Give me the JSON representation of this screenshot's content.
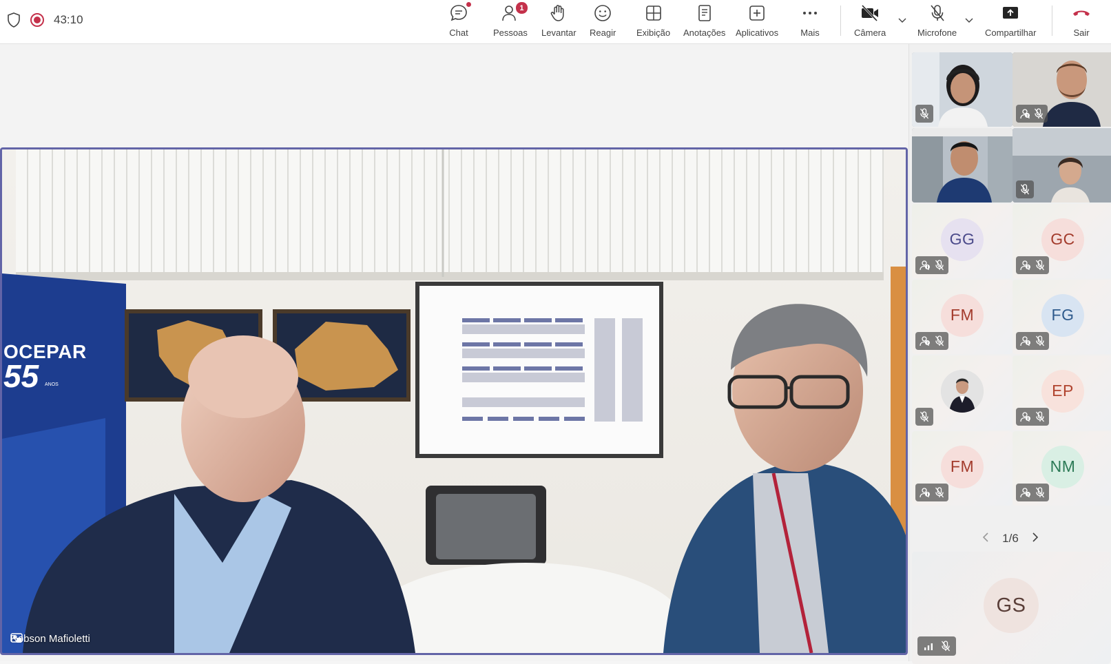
{
  "status": {
    "timer": "43:10"
  },
  "toolbar": {
    "chat": "Chat",
    "people": "Pessoas",
    "people_badge": "1",
    "raise": "Levantar",
    "react": "Reagir",
    "view": "Exibição",
    "notes": "Anotações",
    "apps": "Aplicativos",
    "more": "Mais",
    "camera": "Câmera",
    "mic": "Microfone",
    "share": "Compartilhar",
    "leave": "Sair"
  },
  "main_video": {
    "speaker_name": "Robson Mafioletti",
    "banner_text": "OCEPAR",
    "banner_year": "55",
    "banner_sub": "ANOS"
  },
  "gallery": {
    "tiles": [
      {
        "initials": "GG",
        "avatar_color": "#e6e1f0",
        "text_color": "#4b4a8a"
      },
      {
        "initials": "GC",
        "avatar_color": "#f6dedb",
        "text_color": "#a33b2c"
      },
      {
        "initials": "FM",
        "avatar_color": "#f6dedb",
        "text_color": "#a33b2c"
      },
      {
        "initials": "FG",
        "avatar_color": "#d8e4f2",
        "text_color": "#2e5a8c"
      },
      {
        "initials": "",
        "avatar_color": "#e0e0e0",
        "text_color": "#333333"
      },
      {
        "initials": "EP",
        "avatar_color": "#f8e2dc",
        "text_color": "#b0432e"
      },
      {
        "initials": "FM",
        "avatar_color": "#f6dedb",
        "text_color": "#a33b2c"
      },
      {
        "initials": "NM",
        "avatar_color": "#d9efe4",
        "text_color": "#2c7a56"
      }
    ],
    "page": "1/6",
    "bottom_tile": {
      "initials": "GS",
      "avatar_color": "#efe3df",
      "text_color": "#5a3e38"
    }
  },
  "colors": {
    "accent": "#6264a7",
    "leave_red": "#c4314b"
  }
}
